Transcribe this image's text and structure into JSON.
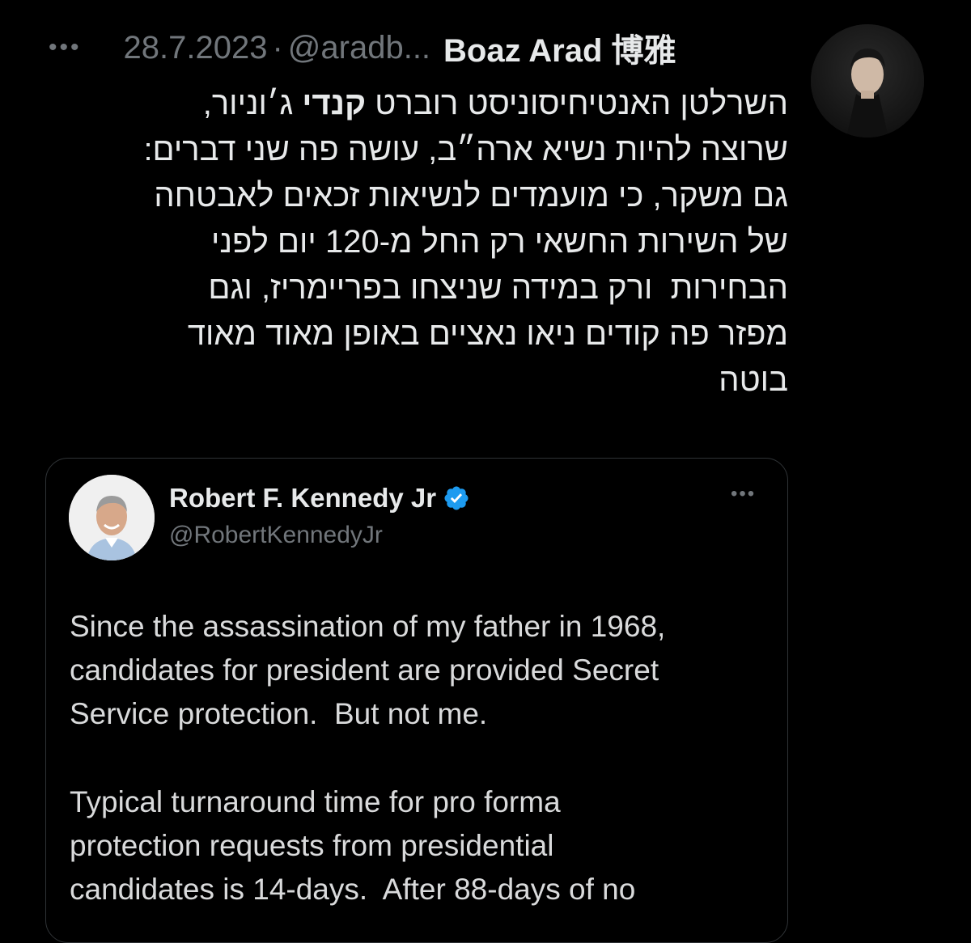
{
  "post": {
    "more_icon": "more-horizontal-icon",
    "date": "28.7.2023",
    "separator": "·",
    "handle": "@aradb...",
    "display_name": "Boaz Arad 博雅",
    "text_lines": [
      [
        "השרלטן האנטיחיסוניסט רוברט ",
        "קנדי",
        " ג׳וניור,"
      ],
      [
        "שרוצה להיות נשיא ארה״ב, עושה פה שני דברים:"
      ],
      [
        "גם משקר, כי מועמדים לנשיאות זכאים לאבטחה"
      ],
      [
        "של השירות החשאי רק החל מ-120 יום לפני"
      ],
      [
        "הבחירות  ורק במידה שניצחו בפריימריז, וגם"
      ],
      [
        "מפזר פה קודים ניאו נאציים באופן מאוד מאוד"
      ],
      [
        "בוטה"
      ]
    ]
  },
  "quoted": {
    "display_name": "Robert F. Kennedy Jr",
    "verified_icon": "verified-badge-icon",
    "verified_color": "#1d9bf0",
    "handle": "@RobertKennedyJr",
    "more_icon": "more-horizontal-icon",
    "paragraph1_lines": [
      "Since the assassination of my father in 1968,",
      "candidates for president are provided Secret",
      "Service protection.  But not me."
    ],
    "paragraph2_lines": [
      "Typical turnaround time for pro forma",
      "protection requests from presidential",
      "candidates is 14-days.  After 88-days of no"
    ]
  },
  "colors": {
    "background": "#000000",
    "text_primary": "#e7e9ea",
    "text_secondary": "#71767b",
    "border": "#2f3336"
  }
}
